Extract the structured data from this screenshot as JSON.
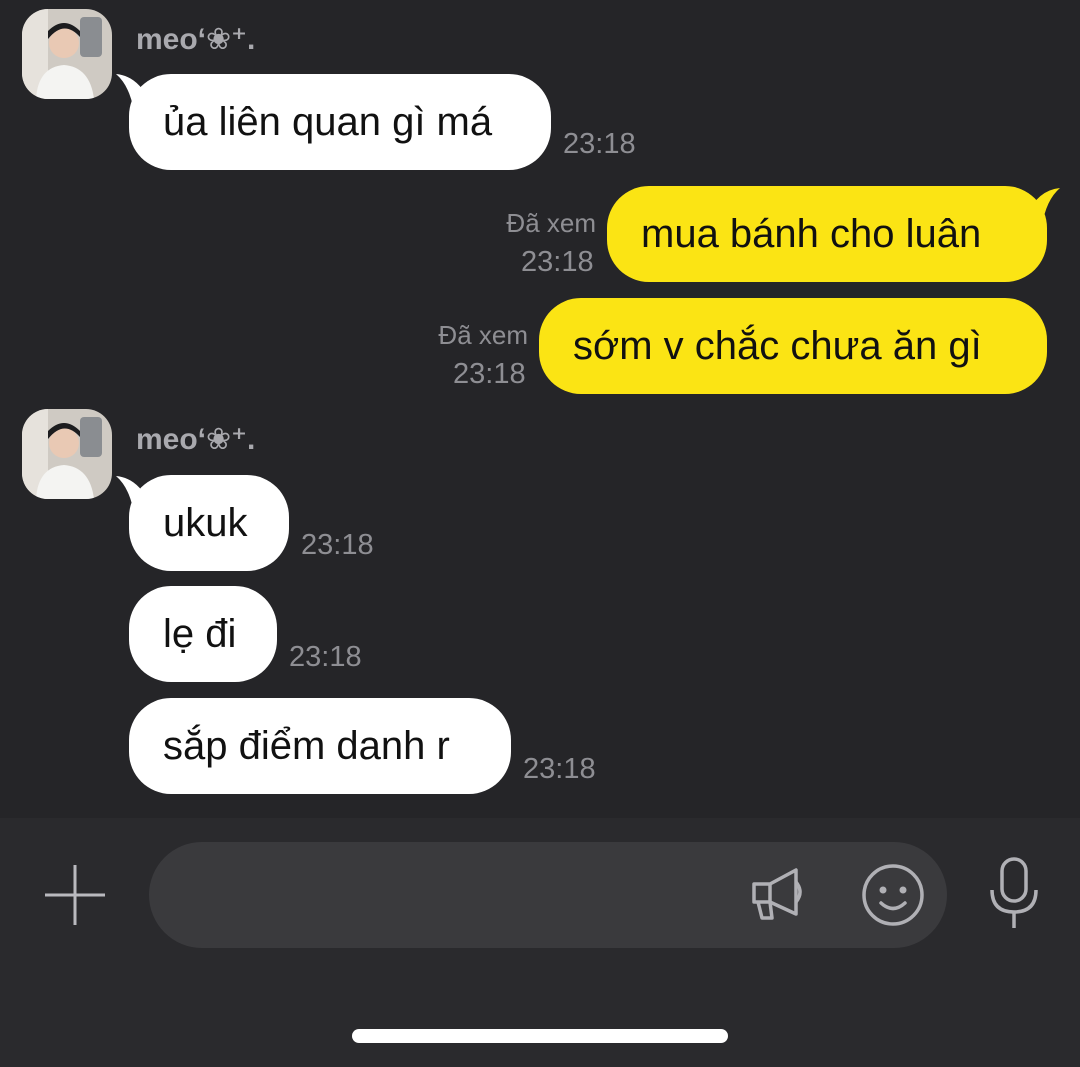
{
  "chat": {
    "groups": [
      {
        "sender": "meo‘❀⁺.",
        "messages": [
          {
            "text": "ủa liên quan gì má",
            "time": "23:18"
          }
        ]
      },
      {
        "sender": "meo‘❀⁺.",
        "messages": [
          {
            "text": "ukuk",
            "time": "23:18"
          },
          {
            "text": "lẹ đi",
            "time": "23:18"
          },
          {
            "text": "sắp điểm danh r",
            "time": "23:18"
          }
        ]
      }
    ],
    "outgoing": [
      {
        "text": "mua bánh cho luân",
        "status": "Đã xem",
        "time": "23:18"
      },
      {
        "text": "sớm v chắc chưa ăn gì",
        "status": "Đã xem",
        "time": "23:18"
      }
    ]
  },
  "input_bar": {
    "placeholder": "",
    "plus_icon": "plus-icon",
    "megaphone_icon": "megaphone-icon",
    "emoji_icon": "smiley-icon",
    "mic_icon": "microphone-icon"
  },
  "colors": {
    "background": "#252528",
    "incoming_bubble": "#ffffff",
    "outgoing_bubble": "#fbe414",
    "muted_text": "#8e8e93"
  }
}
